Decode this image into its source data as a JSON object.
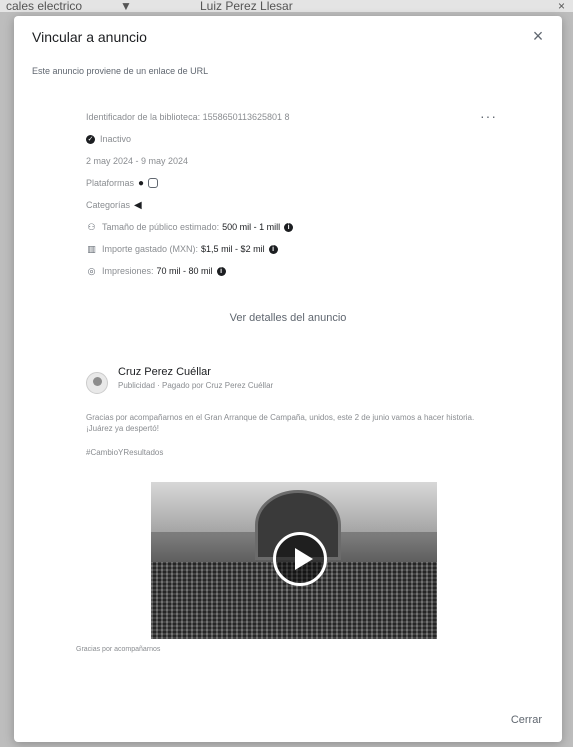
{
  "background": {
    "top_left": "cales electrico",
    "top_mid": "▼",
    "top_right": "Luiz Perez Llesar",
    "top_close": "×"
  },
  "modal": {
    "title": "Vincular a anuncio",
    "close_icon": "×",
    "subtitle": "Este anuncio proviene de un enlace de URL",
    "more_label": "···",
    "library_id": "Identificador de la biblioteca: 1558650113625801 8",
    "status": "Inactivo",
    "dates": "2 may 2024 - 9 may 2024",
    "platforms_label": "Plataformas",
    "categories_label": "Categorías",
    "audience_label": "Tamaño de público estimado:",
    "audience_value": "500 mil - 1 mill",
    "spend_label": "Importe gastado (MXN):",
    "spend_value": "$1,5 mil - $2 mil",
    "impressions_label": "Impresiones:",
    "impressions_value": "70 mil - 80 mil",
    "details_link": "Ver detalles del anuncio",
    "page_name": "Cruz Perez Cuéllar",
    "sponsored": "Publicidad · Pagado por Cruz Perez Cuéllar",
    "post_text": "Gracias por acompañarnos en el Gran Arranque de Campaña, unidos, este 2 de junio vamos a hacer historia. ¡Juárez ya despertó!",
    "hashtag": "#CambioYResultados",
    "caption": "Gracias por acompañarnos",
    "close_button": "Cerrar"
  }
}
